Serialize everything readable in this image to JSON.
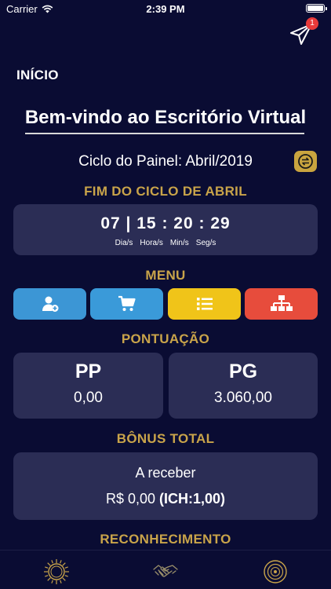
{
  "status_bar": {
    "carrier": "Carrier",
    "time": "2:39 PM"
  },
  "notification": {
    "badge_count": "1"
  },
  "header": {
    "title": "INÍCIO"
  },
  "welcome": {
    "title": "Bem-vindo ao Escritório Virtual"
  },
  "cycle": {
    "label": "Ciclo do Painel: Abril/2019"
  },
  "countdown": {
    "title": "FIM DO CICLO DE ABRIL",
    "days": "07",
    "hours": "15",
    "minutes": "20",
    "seconds": "29",
    "labels": [
      "Dia/s",
      "Hora/s",
      "Min/s",
      "Seg/s"
    ]
  },
  "menu": {
    "title": "MENU",
    "buttons": [
      {
        "icon": "add-user-icon",
        "color": "#3c96d5"
      },
      {
        "icon": "cart-icon",
        "color": "#3a9ad9"
      },
      {
        "icon": "list-icon",
        "color": "#f0c419"
      },
      {
        "icon": "org-chart-icon",
        "color": "#e74c3c"
      }
    ]
  },
  "score": {
    "title": "PONTUAÇÃO",
    "pp": {
      "label": "PP",
      "value": "0,00"
    },
    "pg": {
      "label": "PG",
      "value": "3.060,00"
    }
  },
  "bonus": {
    "title": "BÔNUS TOTAL",
    "status": "A receber",
    "amount": "R$ 0,00",
    "ich": "(ICH:1,00)"
  },
  "recognition": {
    "title": "RECONHECIMENTO"
  },
  "tabs": [
    {
      "icon": "sunburst-icon"
    },
    {
      "icon": "handshake-icon"
    },
    {
      "icon": "medal-icon"
    }
  ],
  "colors": {
    "background": "#0a0c33",
    "card": "#2b2d55",
    "gold": "#c9a44a"
  }
}
